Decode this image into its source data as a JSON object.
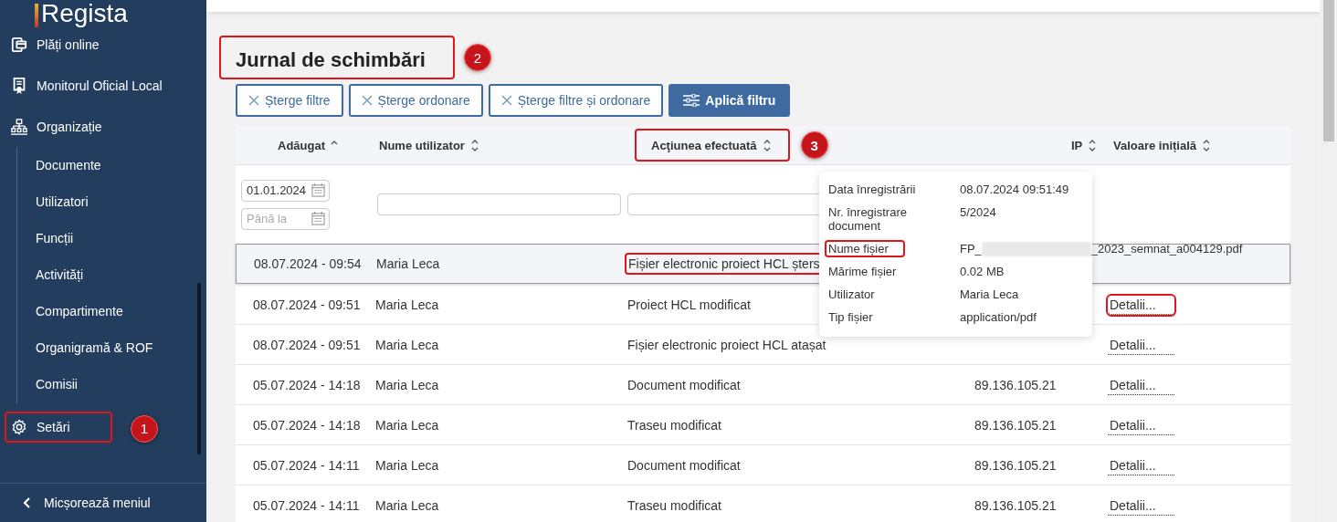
{
  "sidebar": {
    "logo": "Regista",
    "items": [
      {
        "label": "Plăți online",
        "highlighted": false
      },
      {
        "label": "Monitorul Oficial Local",
        "highlighted": false
      },
      {
        "label": "Organizație",
        "highlighted": false,
        "children": [
          {
            "label": "Documente"
          },
          {
            "label": "Utilizatori"
          },
          {
            "label": "Funcții"
          },
          {
            "label": "Activități"
          },
          {
            "label": "Compartimente"
          },
          {
            "label": "Organigramă & ROF"
          },
          {
            "label": "Comisii"
          }
        ]
      },
      {
        "label": "Setări",
        "highlighted": true,
        "callout": "1"
      }
    ],
    "collapse": "Micșorează meniul"
  },
  "page": {
    "title": "Jurnal de schimbări",
    "title_highlighted": true,
    "title_callout": "2"
  },
  "buttons": [
    {
      "label": "Șterge filtre",
      "kind": "clear"
    },
    {
      "label": "Șterge ordonare",
      "kind": "clear"
    },
    {
      "label": "Șterge filtre și ordonare",
      "kind": "clear"
    },
    {
      "label": "Aplică filtru",
      "kind": "apply"
    }
  ],
  "table": {
    "columns": [
      {
        "label": "Adăugat",
        "sorted": true,
        "highlighted": false
      },
      {
        "label": "Nume utilizator",
        "sorted": false,
        "highlighted": false
      },
      {
        "label": "Acţiunea efectuată",
        "sorted": false,
        "highlighted": true,
        "callout": "3"
      },
      {
        "label": "IP",
        "sorted": false,
        "highlighted": false
      },
      {
        "label": "Valoare inițială",
        "sorted": false,
        "highlighted": false
      }
    ],
    "filters": {
      "date_from": "01.01.2024",
      "date_to_placeholder": "Până la"
    },
    "rows": [
      {
        "date": "08.07.2024 - 09:54",
        "user": "Maria Leca",
        "action": "Fișier electronic proiect HCL șters",
        "action_highlighted": true,
        "selected": true
      },
      {
        "date": "08.07.2024 - 09:51",
        "user": "Maria Leca",
        "action": "Proiect HCL modificat",
        "action_highlighted": false,
        "details": "Detalii...",
        "details_highlighted": true,
        "selected": false
      },
      {
        "date": "08.07.2024 - 09:51",
        "user": "Maria Leca",
        "action": "Fișier electronic proiect HCL atașat",
        "action_highlighted": false,
        "details": "Detalii...",
        "details_highlighted": false,
        "selected": false
      },
      {
        "date": "05.07.2024 - 14:18",
        "user": "Maria Leca",
        "action": "Document modificat",
        "action_highlighted": false,
        "ip": "89.136.105.21",
        "details": "Detalii...",
        "details_highlighted": false,
        "selected": false
      },
      {
        "date": "05.07.2024 - 14:18",
        "user": "Maria Leca",
        "action": "Traseu modificat",
        "action_highlighted": false,
        "ip": "89.136.105.21",
        "details": "Detalii...",
        "details_highlighted": false,
        "selected": false
      },
      {
        "date": "05.07.2024 - 14:11",
        "user": "Maria Leca",
        "action": "Document modificat",
        "action_highlighted": false,
        "ip": "89.136.105.21",
        "details": "Detalii...",
        "details_highlighted": false,
        "selected": false
      },
      {
        "date": "05.07.2024 - 14:11",
        "user": "Maria Leca",
        "action": "Traseu modificat",
        "action_highlighted": false,
        "ip": "89.136.105.21",
        "details": "Detalii...",
        "details_highlighted": false,
        "selected": false
      }
    ]
  },
  "tooltip": {
    "rows": [
      {
        "label": "Data înregistrării",
        "value": "08.07.2024 09:51:49",
        "highlighted": false
      },
      {
        "label": "Nr. înregistrare document",
        "value": "5/2024",
        "highlighted": false
      },
      {
        "label": "Nume fișier",
        "value": "FP_",
        "value_end": "_2023_semnat_a004129.pdf",
        "redacted": true,
        "highlighted": true
      },
      {
        "label": "Mărime fișier",
        "value": "0.02 MB",
        "highlighted": false
      },
      {
        "label": "Utilizator",
        "value": "Maria Leca",
        "highlighted": false
      },
      {
        "label": "Tip fișier",
        "value": "application/pdf",
        "highlighted": false
      }
    ]
  }
}
